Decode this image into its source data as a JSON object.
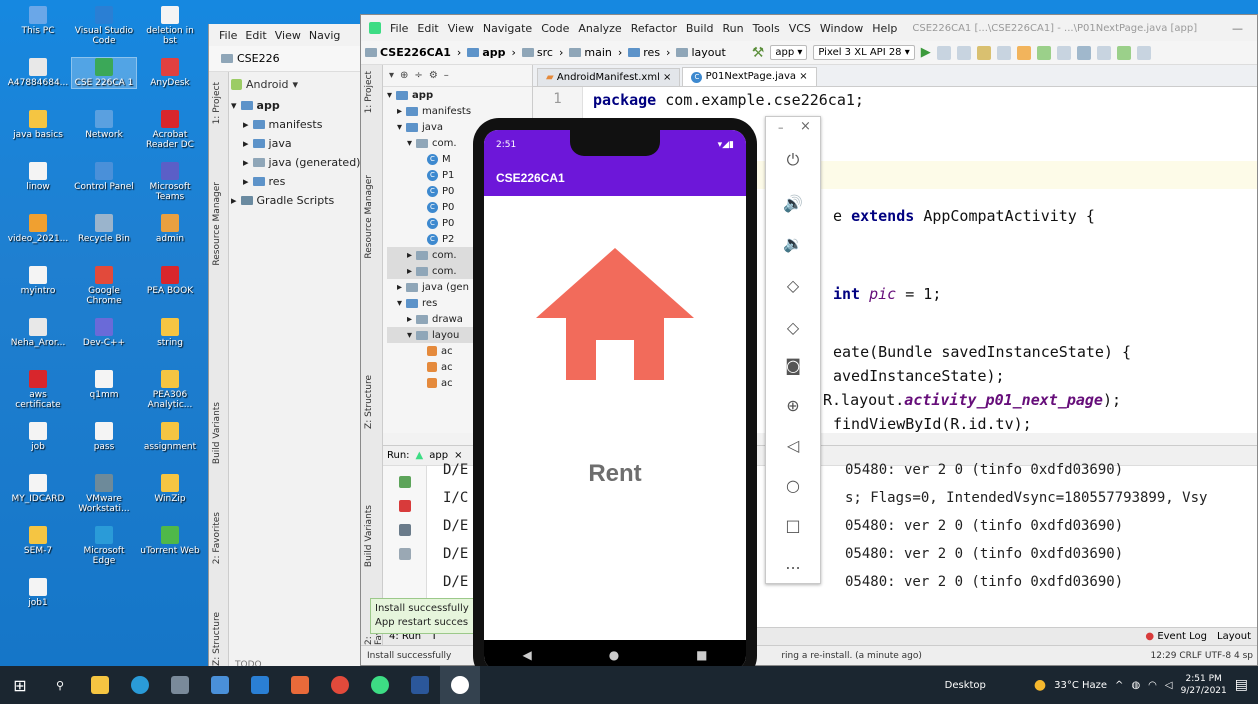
{
  "desktop": {
    "icons": [
      {
        "label": "This PC",
        "color": "#6aa7e8"
      },
      {
        "label": "Visual Studio Code",
        "color": "#2a7fd4"
      },
      {
        "label": "deletion in bst",
        "color": "#f4f4f4"
      },
      {
        "label": "A47884684...",
        "color": "#e8e8e8"
      },
      {
        "label": "CSE 226CA 1",
        "color": "#3ba858"
      },
      {
        "label": "AnyDesk",
        "color": "#e04040"
      },
      {
        "label": "java basics",
        "color": "#f5c542"
      },
      {
        "label": "Network",
        "color": "#5aa0e0"
      },
      {
        "label": "Acrobat Reader DC",
        "color": "#d8262c"
      },
      {
        "label": "linow",
        "color": "#f4f4f4"
      },
      {
        "label": "Control Panel",
        "color": "#4a90d9"
      },
      {
        "label": "Microsoft Teams",
        "color": "#5b5fc7"
      },
      {
        "label": "video_2021...",
        "color": "#f0a030"
      },
      {
        "label": "Recycle Bin",
        "color": "#9ab4cc"
      },
      {
        "label": "admin",
        "color": "#e8a040"
      },
      {
        "label": "myintro",
        "color": "#f4f4f4"
      },
      {
        "label": "Google Chrome",
        "color": "#e24a3b"
      },
      {
        "label": "PEA BOOK",
        "color": "#d8262c"
      },
      {
        "label": "Neha_Aror...",
        "color": "#e8e8e8"
      },
      {
        "label": "Dev-C++",
        "color": "#6a6ad8"
      },
      {
        "label": "string",
        "color": "#f5c542"
      },
      {
        "label": "aws certificate",
        "color": "#d8262c"
      },
      {
        "label": "q1mm",
        "color": "#f4f4f4"
      },
      {
        "label": "PEA306 Analytic...",
        "color": "#f5c542"
      },
      {
        "label": "job",
        "color": "#f4f4f4"
      },
      {
        "label": "pass",
        "color": "#f4f4f4"
      },
      {
        "label": "assignment",
        "color": "#f5c542"
      },
      {
        "label": "MY_IDCARD",
        "color": "#f4f4f4"
      },
      {
        "label": "VMware Workstati...",
        "color": "#6d8a9a"
      },
      {
        "label": "WinZip",
        "color": "#f5c542"
      },
      {
        "label": "SEM-7",
        "color": "#f5c542"
      },
      {
        "label": "Microsoft Edge",
        "color": "#2a9bd8"
      },
      {
        "label": "uTorrent Web",
        "color": "#4fb849"
      },
      {
        "label": "job1",
        "color": "#f4f4f4"
      }
    ]
  },
  "ide_back": {
    "menu": [
      "File",
      "Edit",
      "View",
      "Navig"
    ],
    "project_name": "CSE226",
    "android_label": "Android",
    "tree": [
      "app",
      "manifests",
      "java",
      "java (generated)",
      "res",
      "Gradle Scripts"
    ],
    "tabs_left": [
      "1: Project",
      "Resource Manager",
      "Build Variants",
      "2: Favorites",
      "Z: Structure"
    ],
    "bottom": "TODO"
  },
  "ide": {
    "menu": [
      "File",
      "Edit",
      "View",
      "Navigate",
      "Code",
      "Analyze",
      "Refactor",
      "Build",
      "Run",
      "Tools",
      "VCS",
      "Window",
      "Help"
    ],
    "title": "CSE226CA1 [...\\CSE226CA1] - ...\\P01NextPage.java [app]",
    "breadcrumbs": [
      "CSE226CA1",
      "app",
      "src",
      "main",
      "res",
      "layout"
    ],
    "run_config": "app",
    "device": "Pixel 3 XL API 28",
    "project_tree": [
      "app",
      "manifests",
      "java",
      "com.",
      "M",
      "P1",
      "P0",
      "P0",
      "P0",
      "P2",
      "com.",
      "com.",
      "java (gen",
      "res",
      "drawa",
      "layou",
      "ac",
      "ac",
      "ac"
    ],
    "editor_tabs": [
      "AndroidManifest.xml",
      "P01NextPage.java"
    ],
    "gutter_first": "1",
    "code": {
      "l1_kw": "package",
      "l1": "com.example.cse226ca1;",
      "l2a": "e",
      "l2_kw": "extends",
      "l2b": "AppCompatActivity {",
      "l3_kw": "int",
      "l3_var": "pic",
      "l3b": "= 1;",
      "l4": "eate(Bundle savedInstanceState) {",
      "l5": "avedInstanceState);",
      "l6a": "R.layout.",
      "l6_it": "activity_p01_next_page",
      "l6b": ");",
      "l7": "findViewById(R.id.tv);"
    },
    "run_label": "Run:",
    "run_tab": "app",
    "log_left": [
      "D/E",
      "I/C",
      "D/E",
      "D/E",
      "D/E"
    ],
    "log_right": [
      "05480: ver 2 0 (tinfo 0xdfd03690)",
      "s; Flags=0, IntendedVsync=180557793899, Vsy",
      "05480: ver 2 0 (tinfo 0xdfd03690)",
      "05480: ver 2 0 (tinfo 0xdfd03690)",
      "05480: ver 2 0 (tinfo 0xdfd03690)"
    ],
    "bottom_tabs": [
      "4: Run",
      "T",
      "al",
      "Event Log",
      "Layout"
    ],
    "status_left": "Install successfully",
    "status_mid": "ring a re-install. (a minute ago)",
    "status_right": "12:29  CRLF  UTF-8  4 sp",
    "left_tabs": [
      "1: Project",
      "Resource Manager",
      "Z: Structure",
      "Build Variants",
      "2: Favorites"
    ]
  },
  "toast": {
    "line1": "Install successfully",
    "line2": "App restart succes"
  },
  "phone": {
    "time": "2:51",
    "app_title": "CSE226CA1",
    "content_text": "Rent",
    "app_color": "#6d17d9",
    "house_color": "#f26b5b"
  },
  "emulator_panel": {
    "min": "–",
    "close": "×",
    "more": "..."
  },
  "taskbar": {
    "desktop_label": "Desktop",
    "weather": "33°C Haze",
    "time": "2:51 PM",
    "date": "9/27/2021"
  }
}
